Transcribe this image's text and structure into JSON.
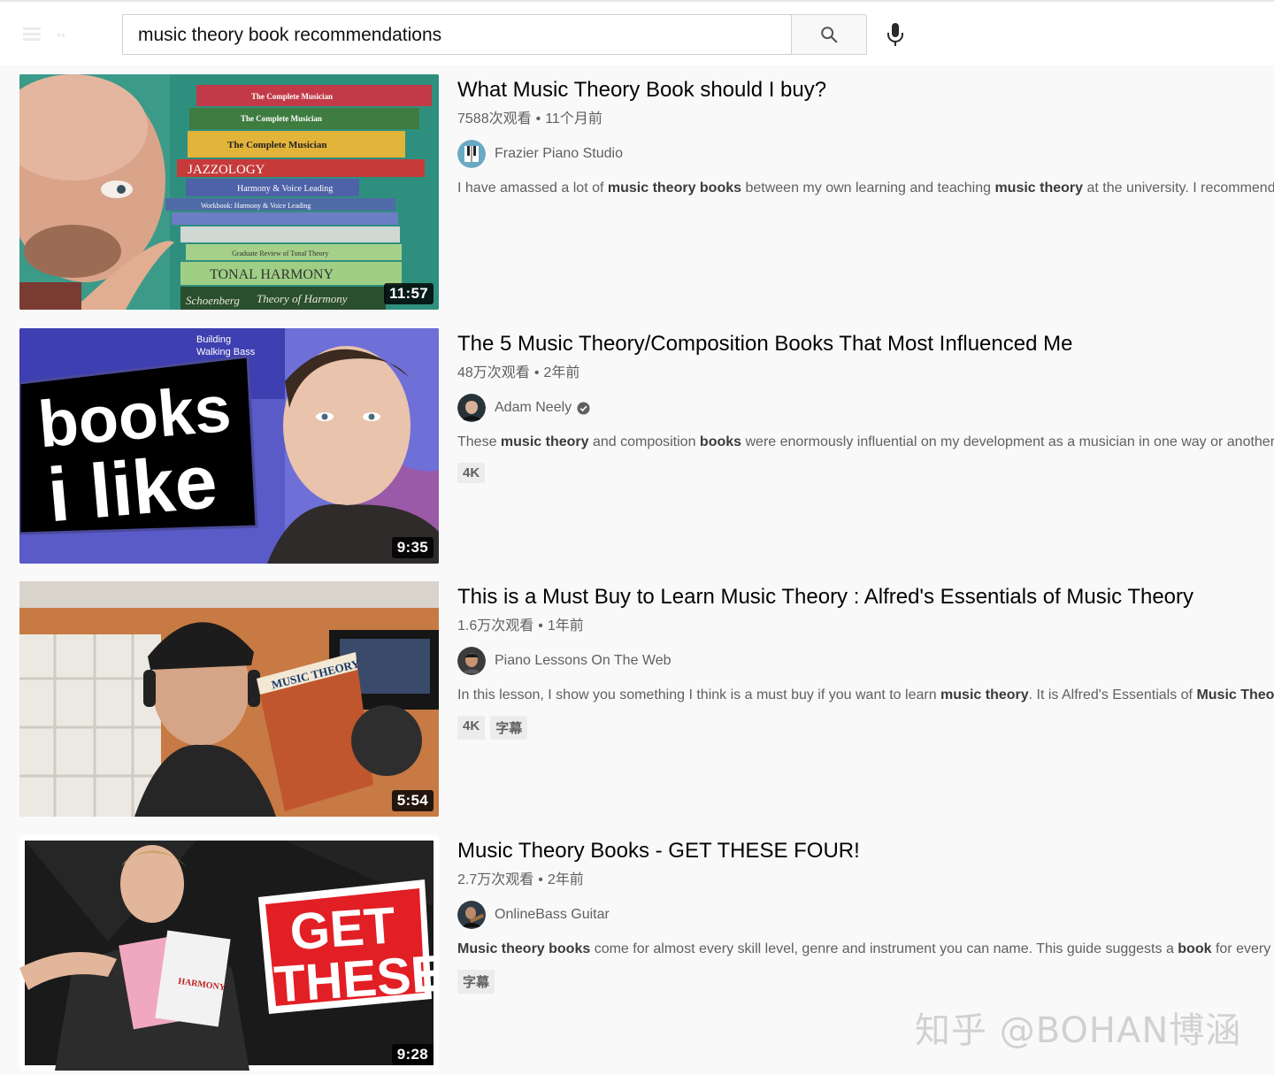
{
  "search": {
    "query": "music theory book recommendations"
  },
  "results": [
    {
      "title": "What Music Theory Book should I buy?",
      "views": "7588次观看",
      "age": "11个月前",
      "channel": "Frazier Piano Studio",
      "verified": false,
      "duration": "11:57",
      "desc": [
        {
          "t": "I have amassed a lot of ",
          "b": false
        },
        {
          "t": "music theory books",
          "b": true
        },
        {
          "t": " between my own learning and teaching ",
          "b": false
        },
        {
          "t": "music theory",
          "b": true
        },
        {
          "t": " at the university. I recommend ...",
          "b": false
        }
      ],
      "badges": []
    },
    {
      "title": "The 5 Music Theory/Composition Books That Most Influenced Me",
      "views": "48万次观看",
      "age": "2年前",
      "channel": "Adam Neely",
      "verified": true,
      "duration": "9:35",
      "desc": [
        {
          "t": "These ",
          "b": false
        },
        {
          "t": "music theory",
          "b": true
        },
        {
          "t": " and composition ",
          "b": false
        },
        {
          "t": "books",
          "b": true
        },
        {
          "t": " were enormously influential on my development as a musician in one way or another.",
          "b": false
        }
      ],
      "badges": [
        "4K"
      ]
    },
    {
      "title": "This is a Must Buy to Learn Music Theory : Alfred's Essentials of Music Theory",
      "views": "1.6万次观看",
      "age": "1年前",
      "channel": "Piano Lessons On The Web",
      "verified": false,
      "duration": "5:54",
      "desc": [
        {
          "t": "In this lesson, I show you something I think is a must buy if you want to learn ",
          "b": false
        },
        {
          "t": "music theory",
          "b": true
        },
        {
          "t": ". It is Alfred's Essentials of ",
          "b": false
        },
        {
          "t": "Music Theory",
          "b": true
        },
        {
          "t": ".",
          "b": false
        }
      ],
      "badges": [
        "4K",
        "字幕"
      ]
    },
    {
      "title": "Music Theory Books - GET THESE FOUR!",
      "views": "2.7万次观看",
      "age": "2年前",
      "channel": "OnlineBass Guitar",
      "verified": false,
      "duration": "9:28",
      "desc": [
        {
          "t": "Music theory books",
          "b": true
        },
        {
          "t": " come for almost every skill level, genre and instrument you can name. This guide suggests a ",
          "b": false
        },
        {
          "t": "book",
          "b": true
        },
        {
          "t": " for every ...",
          "b": false
        }
      ],
      "badges": [
        "字幕"
      ]
    }
  ],
  "thumb_text": {
    "books": [
      "The Complete Musician",
      "The Complete Musician",
      "The Complete Musician",
      "JAZZOLOGY",
      "Harmony & Voice Leading",
      "Workbook: Harmony & Voice Leading",
      "Graduate Review of Tonal Theory",
      "TONAL HARMONY",
      "Theory of Harmony"
    ],
    "book_author": "Schoenberg",
    "thumb2_main": [
      "books",
      "i like"
    ],
    "thumb2_top": [
      "Building",
      "Walking Bass"
    ],
    "thumb3_book": "MUSIC THEORY",
    "thumb4_main": [
      "GET",
      "THESE"
    ],
    "thumb4_book": "HARMONY"
  },
  "watermark": "知乎 @BOHAN博涵",
  "colors": {
    "accent_red": "#e21f25",
    "teal_bg": "#2f8f7f",
    "purple_bg": "#5d5cc4"
  }
}
